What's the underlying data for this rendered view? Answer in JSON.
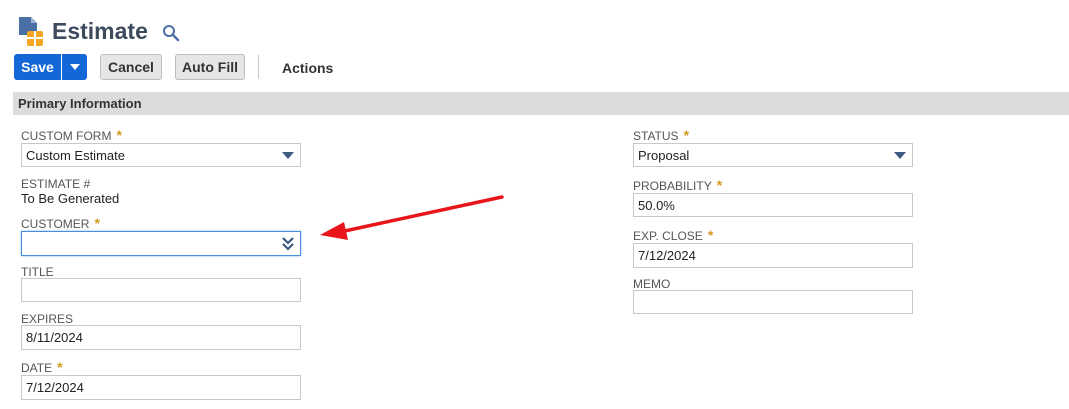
{
  "header": {
    "title": "Estimate"
  },
  "toolbar": {
    "save_label": "Save",
    "cancel_label": "Cancel",
    "autofill_label": "Auto Fill",
    "actions_label": "Actions"
  },
  "section": {
    "title": "Primary Information"
  },
  "left_fields": {
    "custom_form": {
      "label": "CUSTOM FORM",
      "required": "*",
      "value": "Custom Estimate"
    },
    "estimate_no": {
      "label": "ESTIMATE #",
      "value": "To Be Generated"
    },
    "customer": {
      "label": "CUSTOMER",
      "required": "*",
      "value": ""
    },
    "title": {
      "label": "TITLE",
      "value": ""
    },
    "expires": {
      "label": "EXPIRES",
      "value": "8/11/2024"
    },
    "date": {
      "label": "DATE",
      "required": "*",
      "value": "7/12/2024"
    }
  },
  "right_fields": {
    "status": {
      "label": "STATUS",
      "required": "*",
      "value": "Proposal"
    },
    "probability": {
      "label": "PROBABILITY",
      "required": "*",
      "value": "50.0%"
    },
    "exp_close": {
      "label": "EXP. CLOSE",
      "required": "*",
      "value": "7/12/2024"
    },
    "memo": {
      "label": "MEMO",
      "value": ""
    }
  },
  "colors": {
    "primary_button": "#1467d6",
    "required_star": "#d49a1f",
    "annotation_arrow": "#e8161b",
    "section_bar": "#dcdcdc"
  }
}
